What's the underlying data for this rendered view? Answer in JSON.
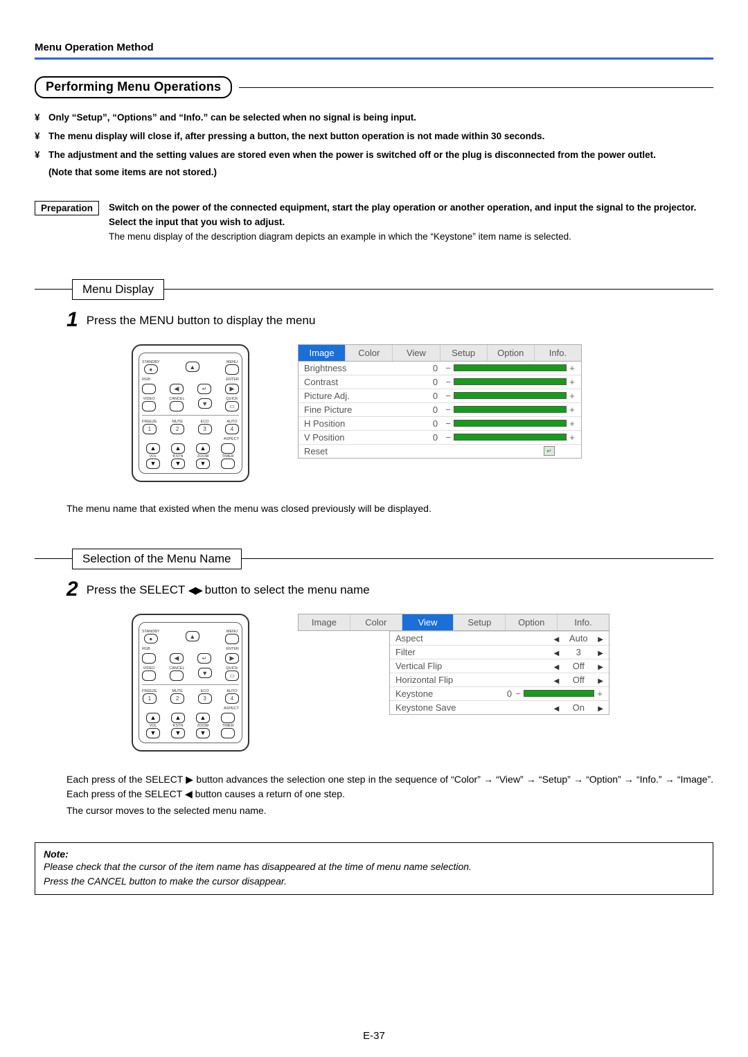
{
  "header": {
    "title": "Menu Operation Method"
  },
  "section_title": "Performing Menu Operations",
  "bullets": {
    "glyph": "¥",
    "b1": "Only “Setup”, “Options” and “Info.” can be selected when no signal is being input.",
    "b2": "The menu display will close if, after pressing a button, the next button operation is not made within 30 seconds.",
    "b3": "The adjustment and the setting values are stored even when the power is switched off or the plug is disconnected from the power outlet.",
    "b3a": "(Note that some items are not stored.)"
  },
  "prep": {
    "label": "Preparation",
    "line1": "Switch on the power of the connected equipment, start the play operation or another operation, and input the signal to the projector.",
    "line2": "Select the input that you wish to adjust.",
    "line3": "The menu display of the description diagram depicts an example in which the “Keystone” item name is selected."
  },
  "step1": {
    "label_box": "Menu Display",
    "num": "1",
    "text": "Press the MENU button to display the menu",
    "caption": "The menu name that existed when the menu was closed previously will be displayed."
  },
  "step2": {
    "label_box": "Selection of the Menu Name",
    "num": "2",
    "text_a": "Press the SELECT ",
    "text_b": " button to select the menu name",
    "cap1": "Each press of the SELECT ▶ button advances the selection one step in the sequence of “Color” → “View” → “Setup” → “Option” → “Info.” → “Image”. Each press of the SELECT ◀ button causes a return of one step.",
    "cap2": "The cursor moves to the selected menu name."
  },
  "remote": {
    "standby": "STANDBY",
    "menu": "MENU",
    "rgb": "RGB",
    "enter": "ENTER",
    "video": "VIDEO",
    "cancel": "CANCEL",
    "quick": "QUICK",
    "freeze": "FREEZE",
    "mute": "MUTE",
    "eco": "ECO",
    "auto": "AUTO",
    "aspect": "ASPECT",
    "vol": "VOL",
    "kstn": "KSTN",
    "zoom": "ZOOM",
    "timer": "TIMER",
    "n1": "1",
    "n2": "2",
    "n3": "3",
    "n4": "4"
  },
  "osd_tabs": {
    "image": "Image",
    "color": "Color",
    "view": "View",
    "setup": "Setup",
    "option": "Option",
    "info": "Info."
  },
  "osd1": {
    "r1": {
      "l": "Brightness",
      "v": "0"
    },
    "r2": {
      "l": "Contrast",
      "v": "0"
    },
    "r3": {
      "l": "Picture Adj.",
      "v": "0"
    },
    "r4": {
      "l": "Fine Picture",
      "v": "0"
    },
    "r5": {
      "l": "H Position",
      "v": "0"
    },
    "r6": {
      "l": "V Position",
      "v": "0"
    },
    "reset": "Reset"
  },
  "osd2": {
    "r1": {
      "l": "Aspect",
      "v": "Auto"
    },
    "r2": {
      "l": "Filter",
      "v": "3"
    },
    "r3": {
      "l": "Vertical Flip",
      "v": "Off"
    },
    "r4": {
      "l": "Horizontal Flip",
      "v": "Off"
    },
    "r5": {
      "l": "Keystone",
      "v": "0"
    },
    "r6": {
      "l": "Keystone Save",
      "v": "On"
    }
  },
  "note": {
    "title": "Note:",
    "l1": "Please check that the cursor of the item name has disappeared at the time of menu name selection.",
    "l2": "Press the CANCEL button to make the cursor disappear."
  },
  "page_num": "E-37"
}
